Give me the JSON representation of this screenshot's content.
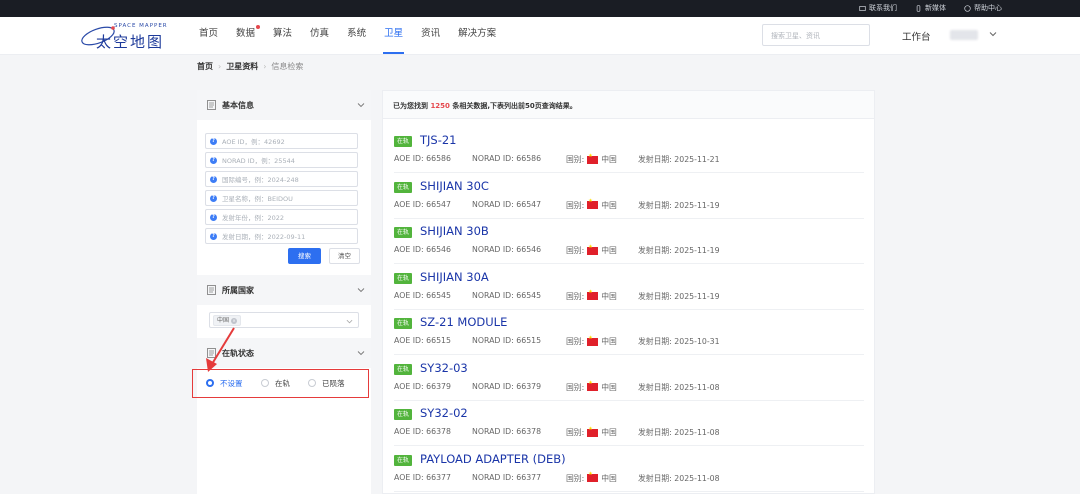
{
  "topbar": {
    "links": [
      {
        "icon": "contact-icon",
        "label": "联系我们"
      },
      {
        "icon": "mobile-icon",
        "label": "新媒体"
      },
      {
        "icon": "help-icon",
        "label": "帮助中心"
      }
    ]
  },
  "header": {
    "logo_en": "SPACE MAPPER",
    "logo_cn": "太空地图",
    "nav": [
      "首页",
      "数据",
      "算法",
      "仿真",
      "系统",
      "卫星",
      "资讯",
      "解决方案"
    ],
    "active_nav": "卫星",
    "search_placeholder": "搜索卫星、资讯",
    "workbench": "工作台"
  },
  "breadcrumb": [
    "首页",
    "卫星资料",
    "信息检索"
  ],
  "sidebar": {
    "basic_title": "基本信息",
    "fields": [
      "AOE ID，例：42692",
      "NORAD ID，例：25544",
      "国际编号，例：2024-248",
      "卫星名称，例：BEIDOU",
      "发射年份，例：2022",
      "发射日期，例：2022-09-11"
    ],
    "search_btn": "搜索",
    "clear_btn": "清空",
    "country_title": "所属国家",
    "country_tag": "中国",
    "status_title": "在轨状态",
    "status_options": [
      "不设置",
      "在轨",
      "已陨落"
    ],
    "status_selected": "不设置"
  },
  "results": {
    "summary_prefix": "已为您找到",
    "count": "1250",
    "summary_suffix": "条相关数据,下表列出前50页查询结果。",
    "items": [
      {
        "badge": "在轨",
        "name": "TJS-21",
        "aoe": "AOE ID: 66586",
        "norad": "NORAD ID: 66586",
        "country_label": "国别:",
        "country": "中国",
        "date": "发射日期: 2025-11-21"
      },
      {
        "badge": "在轨",
        "name": "SHIJIAN 30C",
        "aoe": "AOE ID: 66547",
        "norad": "NORAD ID: 66547",
        "country_label": "国别:",
        "country": "中国",
        "date": "发射日期: 2025-11-19"
      },
      {
        "badge": "在轨",
        "name": "SHIJIAN 30B",
        "aoe": "AOE ID: 66546",
        "norad": "NORAD ID: 66546",
        "country_label": "国别:",
        "country": "中国",
        "date": "发射日期: 2025-11-19"
      },
      {
        "badge": "在轨",
        "name": "SHIJIAN 30A",
        "aoe": "AOE ID: 66545",
        "norad": "NORAD ID: 66545",
        "country_label": "国别:",
        "country": "中国",
        "date": "发射日期: 2025-11-19"
      },
      {
        "badge": "在轨",
        "name": "SZ-21 MODULE",
        "aoe": "AOE ID: 66515",
        "norad": "NORAD ID: 66515",
        "country_label": "国别:",
        "country": "中国",
        "date": "发射日期: 2025-10-31"
      },
      {
        "badge": "在轨",
        "name": "SY32-03",
        "aoe": "AOE ID: 66379",
        "norad": "NORAD ID: 66379",
        "country_label": "国别:",
        "country": "中国",
        "date": "发射日期: 2025-11-08"
      },
      {
        "badge": "在轨",
        "name": "SY32-02",
        "aoe": "AOE ID: 66378",
        "norad": "NORAD ID: 66378",
        "country_label": "国别:",
        "country": "中国",
        "date": "发射日期: 2025-11-08"
      },
      {
        "badge": "在轨",
        "name": "PAYLOAD ADAPTER (DEB)",
        "aoe": "AOE ID: 66377",
        "norad": "NORAD ID: 66377",
        "country_label": "国别:",
        "country": "中国",
        "date": "发射日期: 2025-11-08"
      }
    ]
  },
  "colors": {
    "accent": "#2d6ff0",
    "badge": "#52b43c",
    "highlight": "#e53b3b",
    "title": "#1a35a8"
  }
}
